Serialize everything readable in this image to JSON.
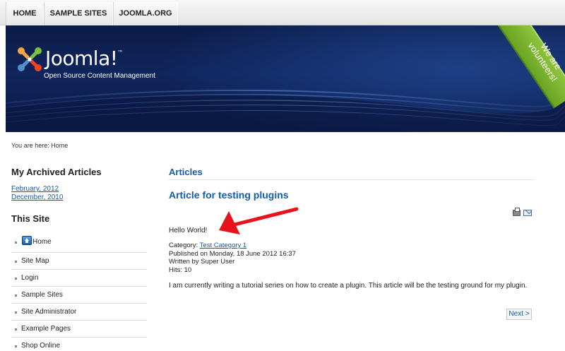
{
  "nav": {
    "tabs": [
      "HOME",
      "SAMPLE SITES",
      "JOOMLA.ORG"
    ]
  },
  "header": {
    "logo_text": "Joomla!",
    "logo_tm": "™",
    "tagline": "Open Source Content Management",
    "ribbon_line1": "We are",
    "ribbon_line2": "volunteers!"
  },
  "breadcrumb": "You are here: Home",
  "sidebar": {
    "archived_heading": "My Archived Articles",
    "archived_items": [
      "February, 2012",
      "December, 2010"
    ],
    "site_heading": "This Site",
    "menu_items": [
      "Home",
      "Site Map",
      "Login",
      "Sample Sites",
      "Site Administrator",
      "Example Pages",
      "Shop Online"
    ]
  },
  "main": {
    "section_heading": "Articles",
    "article_title": "Article for testing plugins",
    "hello_text": "Hello World!",
    "meta": {
      "category_label": "Category: ",
      "category_link": "Test Category 1",
      "published": "Published on Monday, 18 June 2012 16:37",
      "author": "Written by Super User",
      "hits": "Hits: 10"
    },
    "body_text": "I am currently writing a tutorial series on how to create a plugin. This article will be the testing ground for my plugin.",
    "next_label": "Next >"
  },
  "colors": {
    "link": "#135cae",
    "banner": "#0c1c47",
    "ribbon": "#7ab32e",
    "arrow": "#e8131a"
  },
  "icons": [
    "joomla-logo-icon",
    "home-icon",
    "print-icon",
    "email-icon",
    "annotation-arrow-icon"
  ]
}
